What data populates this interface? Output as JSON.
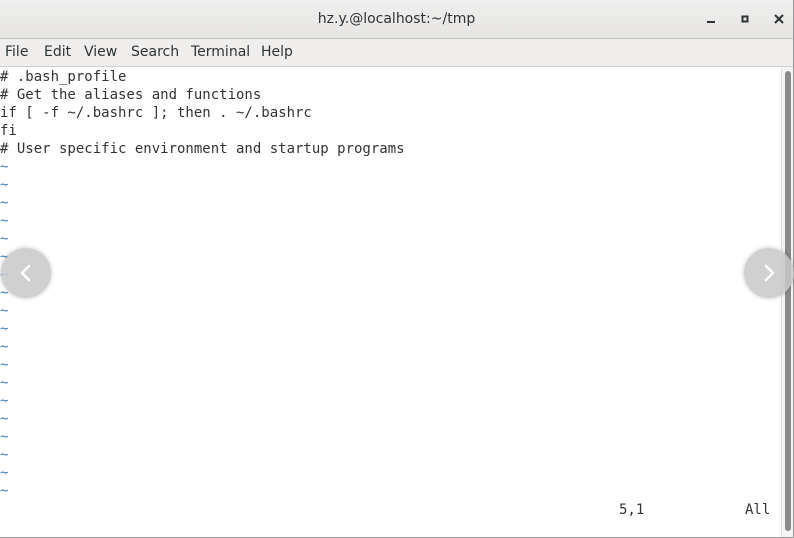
{
  "window": {
    "title": "hz.y.@localhost:~/tmp",
    "controls": [
      "minimize-icon",
      "maximize-icon",
      "close-icon"
    ]
  },
  "menubar": {
    "items": [
      {
        "label": "File"
      },
      {
        "label": "Edit"
      },
      {
        "label": "View"
      },
      {
        "label": "Search"
      },
      {
        "label": "Terminal"
      },
      {
        "label": "Help"
      }
    ]
  },
  "terminal": {
    "lines": [
      "# .bash_profile",
      "# Get the aliases and functions",
      "if [ -f ~/.bashrc ]; then . ~/.bashrc",
      "fi",
      "# User specific environment and startup programs"
    ],
    "empty_line_marker": "~",
    "status": {
      "position": "5,1",
      "scroll": "All"
    }
  },
  "overlay": {
    "prev_icon": "chevron-left-icon",
    "next_icon": "chevron-right-icon"
  },
  "colors": {
    "tilde": "#3a7ec4",
    "text": "#333333",
    "titlebar": "#e9e8e6"
  }
}
